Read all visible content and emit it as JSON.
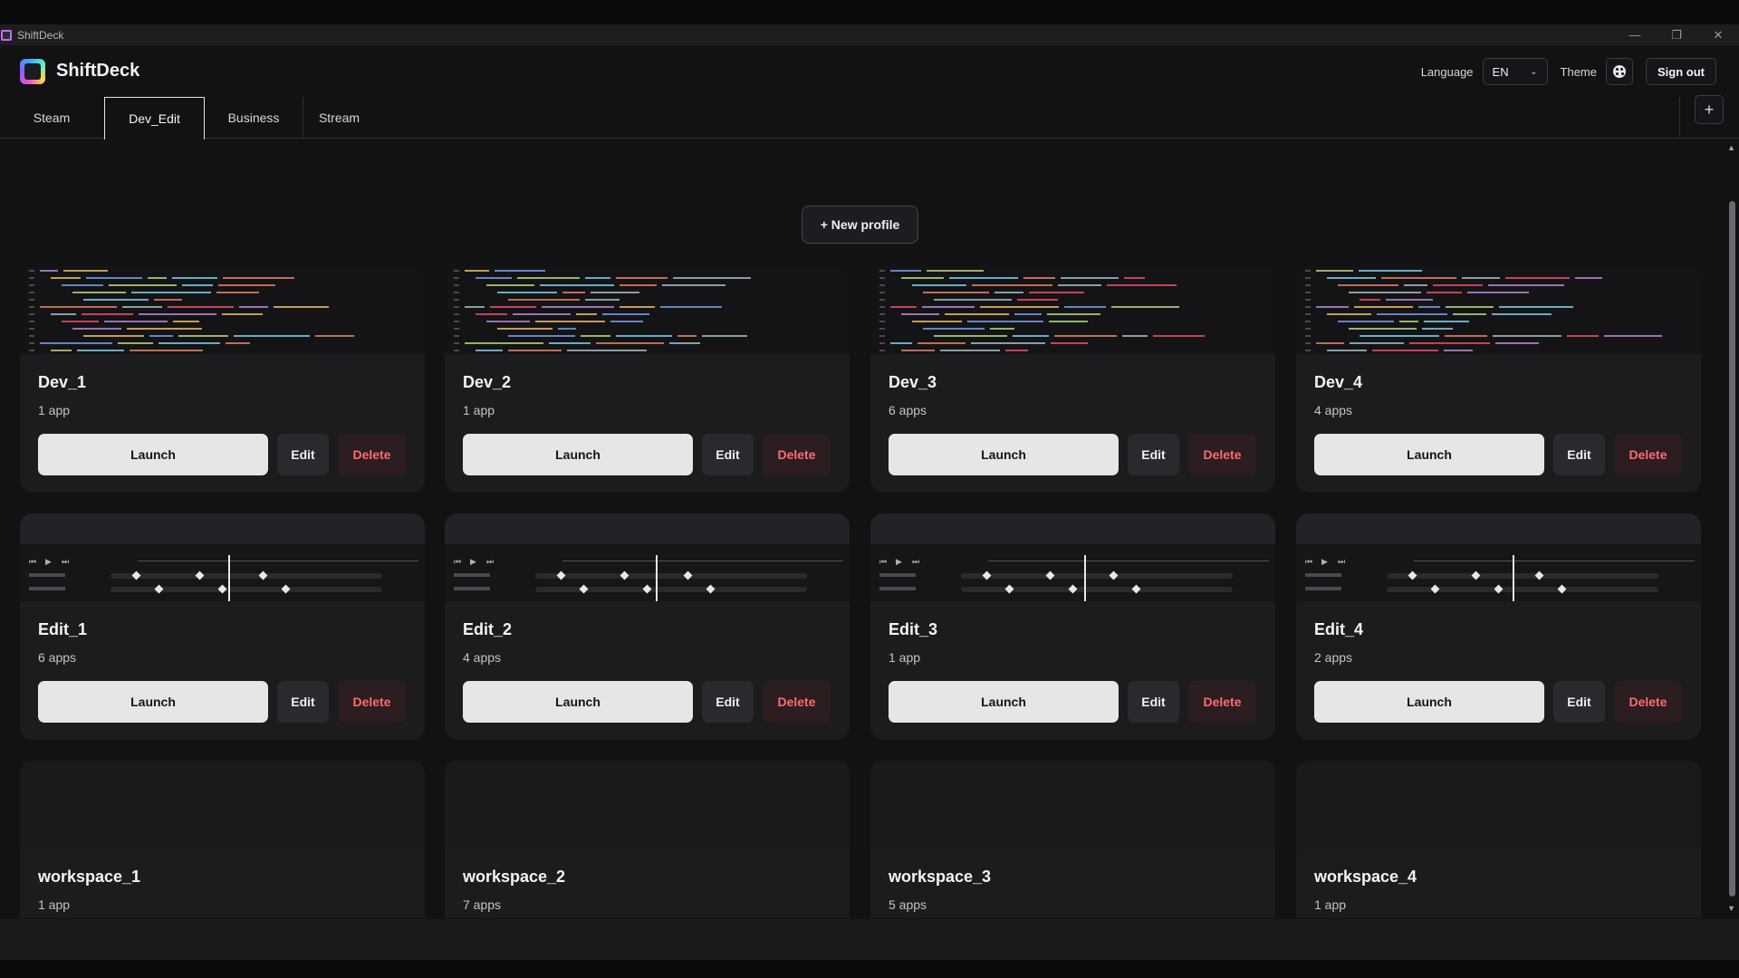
{
  "window": {
    "title": "ShiftDeck",
    "controls": [
      "—",
      "❐",
      "✕"
    ]
  },
  "header": {
    "brand": "ShiftDeck",
    "language_label": "Language",
    "language_value": "EN",
    "theme_label": "Theme",
    "sign_out": "Sign out"
  },
  "tabs": [
    {
      "label": "Steam"
    },
    {
      "label": "Dev_Edit",
      "active": true
    },
    {
      "label": "Business"
    },
    {
      "label": "Stream"
    }
  ],
  "add_tab": "+",
  "new_profile": "+ New profile",
  "buttons": {
    "launch": "Launch",
    "edit": "Edit",
    "delete": "Delete"
  },
  "profiles": [
    {
      "name": "Dev_1",
      "count": "1 app",
      "preview": "code"
    },
    {
      "name": "Dev_2",
      "count": "1 app",
      "preview": "code"
    },
    {
      "name": "Dev_3",
      "count": "6 apps",
      "preview": "code"
    },
    {
      "name": "Dev_4",
      "count": "4 apps",
      "preview": "code"
    },
    {
      "name": "Edit_1",
      "count": "6 apps",
      "preview": "timeline"
    },
    {
      "name": "Edit_2",
      "count": "4 apps",
      "preview": "timeline"
    },
    {
      "name": "Edit_3",
      "count": "1 app",
      "preview": "timeline"
    },
    {
      "name": "Edit_4",
      "count": "2 apps",
      "preview": "timeline"
    },
    {
      "name": "workspace_1",
      "count": "1 app",
      "preview": "none"
    },
    {
      "name": "workspace_2",
      "count": "7 apps",
      "preview": "none"
    },
    {
      "name": "workspace_3",
      "count": "5 apps",
      "preview": "none"
    },
    {
      "name": "workspace_4",
      "count": "1 app",
      "preview": "none"
    }
  ],
  "colors": {
    "delete_text": "#ff6b72",
    "launch_bg": "#e6e6e8",
    "accent_logo": "#c86df0"
  }
}
